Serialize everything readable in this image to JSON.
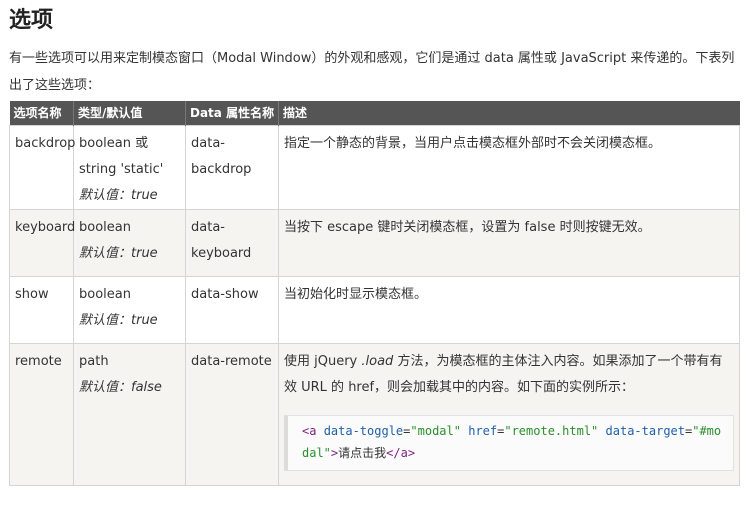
{
  "heading": "选项",
  "intro": "有一些选项可以用来定制模态窗口（Modal Window）的外观和感观，它们是通过 data 属性或 JavaScript 来传递的。下表列出了这些选项：",
  "table": {
    "headers": [
      "选项名称",
      "类型/默认值",
      "Data 属性名称",
      "描述"
    ],
    "rows": [
      {
        "name": "backdrop",
        "type": "boolean 或 string 'static'",
        "default": "默认值：true",
        "attr": "data-backdrop",
        "desc": "指定一个静态的背景，当用户点击模态框外部时不会关闭模态框。"
      },
      {
        "name": "keyboard",
        "type": "boolean",
        "default": "默认值：true",
        "attr": "data-keyboard",
        "desc": "当按下 escape 键时关闭模态框，设置为 false 时则按键无效。"
      },
      {
        "name": "show",
        "type": "boolean",
        "default": "默认值：true",
        "attr": "data-show",
        "desc": "当初始化时显示模态框。"
      },
      {
        "name": "remote",
        "type": "path",
        "default": "默认值：false",
        "attr": "data-remote",
        "desc_before": "使用 jQuery ",
        "desc_em": ".load",
        "desc_after": " 方法，为模态框的主体注入内容。如果添加了一个带有有效 URL 的 href，则会加载其中的内容。如下面的实例所示：",
        "code": {
          "open_tag": "<a",
          "attr1": "data-toggle",
          "val1": "\"modal\"",
          "attr2": "href",
          "val2": "\"remote.html\"",
          "attr3": "data-target",
          "val3": "\"#modal\"",
          "tag_close": ">",
          "text": "请点击我",
          "end_tag": "</a>"
        }
      }
    ]
  }
}
